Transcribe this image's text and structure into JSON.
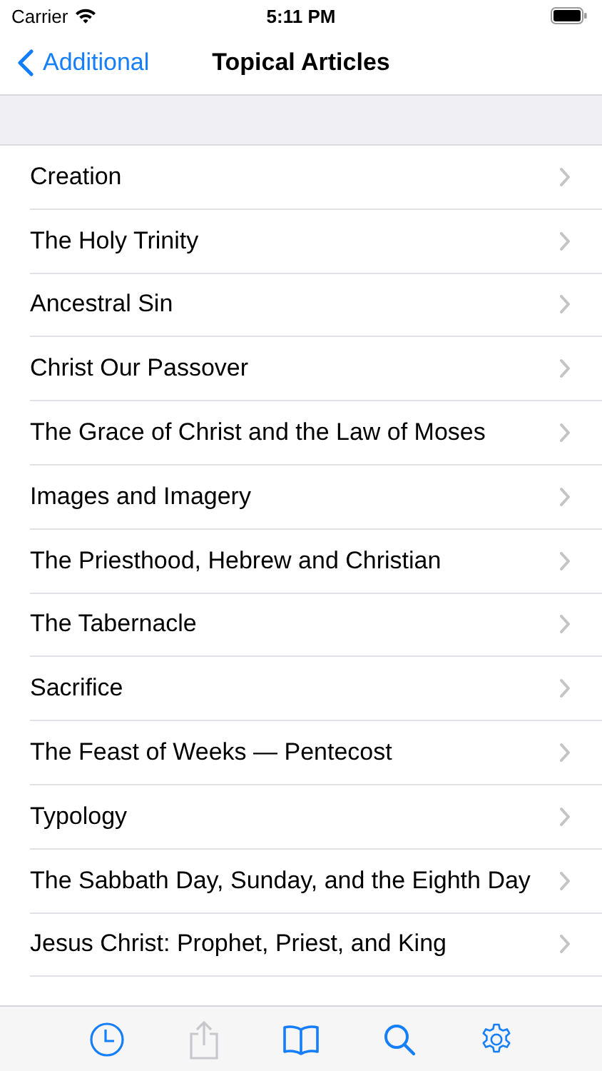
{
  "status_bar": {
    "carrier": "Carrier",
    "time": "5:11 PM"
  },
  "nav_bar": {
    "back_label": "Additional",
    "title": "Topical Articles"
  },
  "articles": [
    {
      "title": "Creation"
    },
    {
      "title": "The Holy Trinity"
    },
    {
      "title": "Ancestral Sin"
    },
    {
      "title": "Christ Our Passover"
    },
    {
      "title": "The Grace of Christ and the Law of Moses"
    },
    {
      "title": "Images and Imagery"
    },
    {
      "title": "The Priesthood, Hebrew and Christian"
    },
    {
      "title": "The Tabernacle"
    },
    {
      "title": "Sacrifice"
    },
    {
      "title": "The Feast of Weeks — Pentecost"
    },
    {
      "title": "Typology"
    },
    {
      "title": "The Sabbath Day, Sunday, and the Eighth Day"
    },
    {
      "title": "Jesus Christ: Prophet, Priest, and King"
    }
  ],
  "toolbar": [
    {
      "kind": "history",
      "disabled": false
    },
    {
      "kind": "share",
      "disabled": true
    },
    {
      "kind": "book",
      "disabled": false
    },
    {
      "kind": "search",
      "disabled": false
    },
    {
      "kind": "settings",
      "disabled": false
    }
  ]
}
